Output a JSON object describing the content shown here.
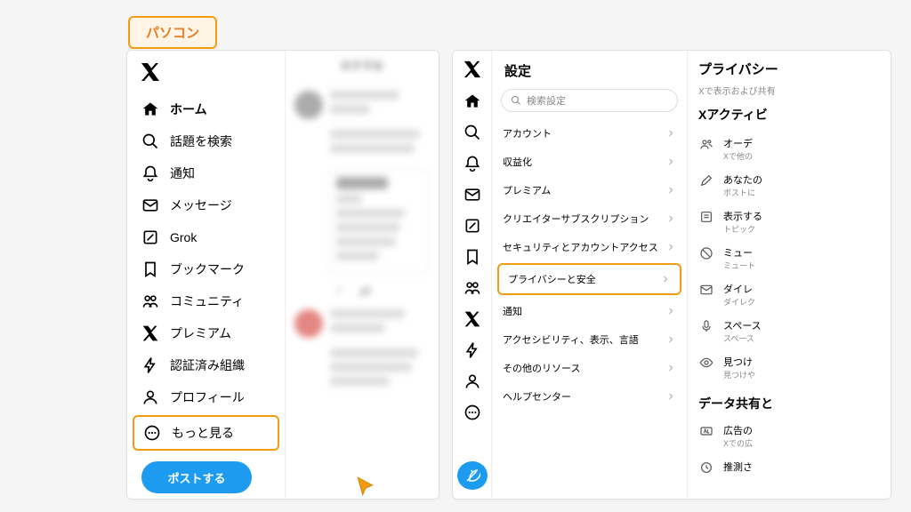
{
  "badge": "パソコン",
  "left": {
    "feed_tab": "おすすめ",
    "nav": [
      {
        "icon": "home",
        "label": "ホーム",
        "active": true
      },
      {
        "icon": "search",
        "label": "話題を検索"
      },
      {
        "icon": "bell",
        "label": "通知"
      },
      {
        "icon": "mail",
        "label": "メッセージ"
      },
      {
        "icon": "grok",
        "label": "Grok"
      },
      {
        "icon": "bookmark",
        "label": "ブックマーク"
      },
      {
        "icon": "community",
        "label": "コミュニティ"
      },
      {
        "icon": "x",
        "label": "プレミアム"
      },
      {
        "icon": "bolt",
        "label": "認証済み組織"
      },
      {
        "icon": "profile",
        "label": "プロフィール"
      },
      {
        "icon": "more",
        "label": "もっと見る",
        "highlight": true
      }
    ],
    "post_button": "ポストする"
  },
  "right": {
    "icon_nav": [
      "x",
      "home",
      "search",
      "bell",
      "mail",
      "grok",
      "bookmark",
      "community",
      "x",
      "bolt",
      "profile",
      "more"
    ],
    "settings_title": "設定",
    "search_placeholder": "検索設定",
    "settings_items": [
      {
        "label": "アカウント"
      },
      {
        "label": "収益化"
      },
      {
        "label": "プレミアム"
      },
      {
        "label": "クリエイターサブスクリプション"
      },
      {
        "label": "セキュリティとアカウントアクセス"
      },
      {
        "label": "プライバシーと安全",
        "highlight": true
      },
      {
        "label": "通知"
      },
      {
        "label": "アクセシビリティ、表示、言語"
      },
      {
        "label": "その他のリソース"
      },
      {
        "label": "ヘルプセンター"
      }
    ],
    "detail_title": "プライバシー",
    "detail_desc": "Xで表示および共有",
    "detail_subtitle": "Xアクティビ",
    "detail_items": [
      {
        "icon": "users",
        "title": "オーデ",
        "sub": "Xで他の"
      },
      {
        "icon": "pen",
        "title": "あなたの",
        "sub": "ポストに"
      },
      {
        "icon": "content",
        "title": "表示する",
        "sub": "トピック"
      },
      {
        "icon": "mute",
        "title": "ミュー",
        "sub": "ミュート"
      },
      {
        "icon": "dm",
        "title": "ダイレ",
        "sub": "ダイレク"
      },
      {
        "icon": "mic",
        "title": "スペース",
        "sub": "スペース"
      },
      {
        "icon": "eye",
        "title": "見つけ",
        "sub": "見つけや"
      }
    ],
    "data_section_title": "データ共有と",
    "data_items": [
      {
        "icon": "ad",
        "title": "広告の",
        "sub": "Xでの広"
      },
      {
        "icon": "infer",
        "title": "推測さ",
        "sub": ""
      }
    ]
  }
}
